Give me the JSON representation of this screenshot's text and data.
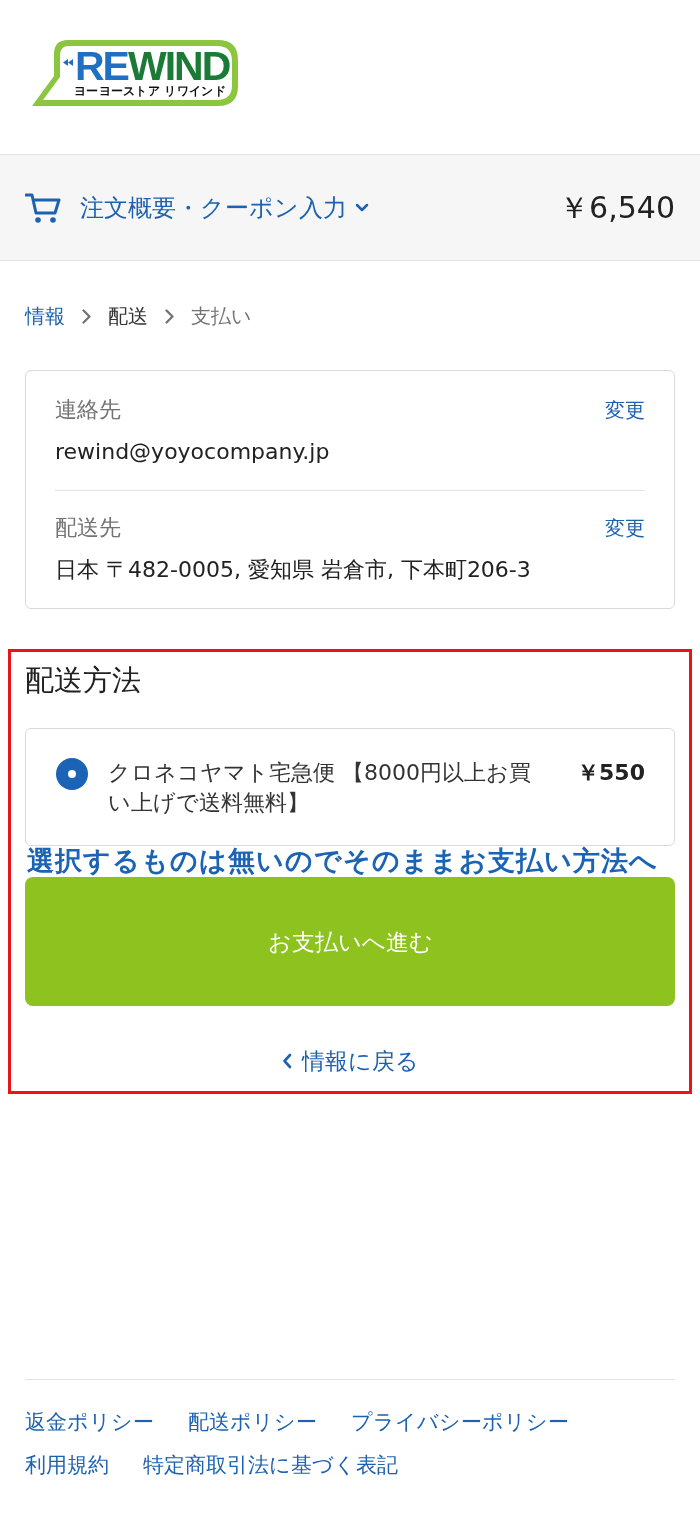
{
  "logo": {
    "wordmark": "REWIND",
    "tagline": "ヨーヨーストア リワインド"
  },
  "order_summary": {
    "label": "注文概要・クーポン入力",
    "expanded": false,
    "total": "￥6,540"
  },
  "breadcrumb": [
    {
      "label": "情報",
      "kind": "link"
    },
    {
      "label": "配送",
      "kind": "current"
    },
    {
      "label": "支払い",
      "kind": "upcoming"
    }
  ],
  "review": [
    {
      "label": "連絡先",
      "value": "rewind@yoyocompany.jp",
      "action": "変更"
    },
    {
      "label": "配送先",
      "value": "日本 〒482-0005, 愛知県 岩倉市, 下本町206-3",
      "action": "変更"
    }
  ],
  "shipping": {
    "heading": "配送方法",
    "options": [
      {
        "label": "クロネコヤマト宅急便 【8000円以上お買い上げで送料無料】",
        "price": "￥550",
        "selected": true
      }
    ]
  },
  "annotation": {
    "highlight": true,
    "note": "選択するものは無いのでそのままお支払い方法へ"
  },
  "continue_button": "お支払いへ進む",
  "back_link": "情報に戻る",
  "footer_links": [
    "返金ポリシー",
    "配送ポリシー",
    "プライバシーポリシー",
    "利用規約",
    "特定商取引法に基づく表記"
  ]
}
